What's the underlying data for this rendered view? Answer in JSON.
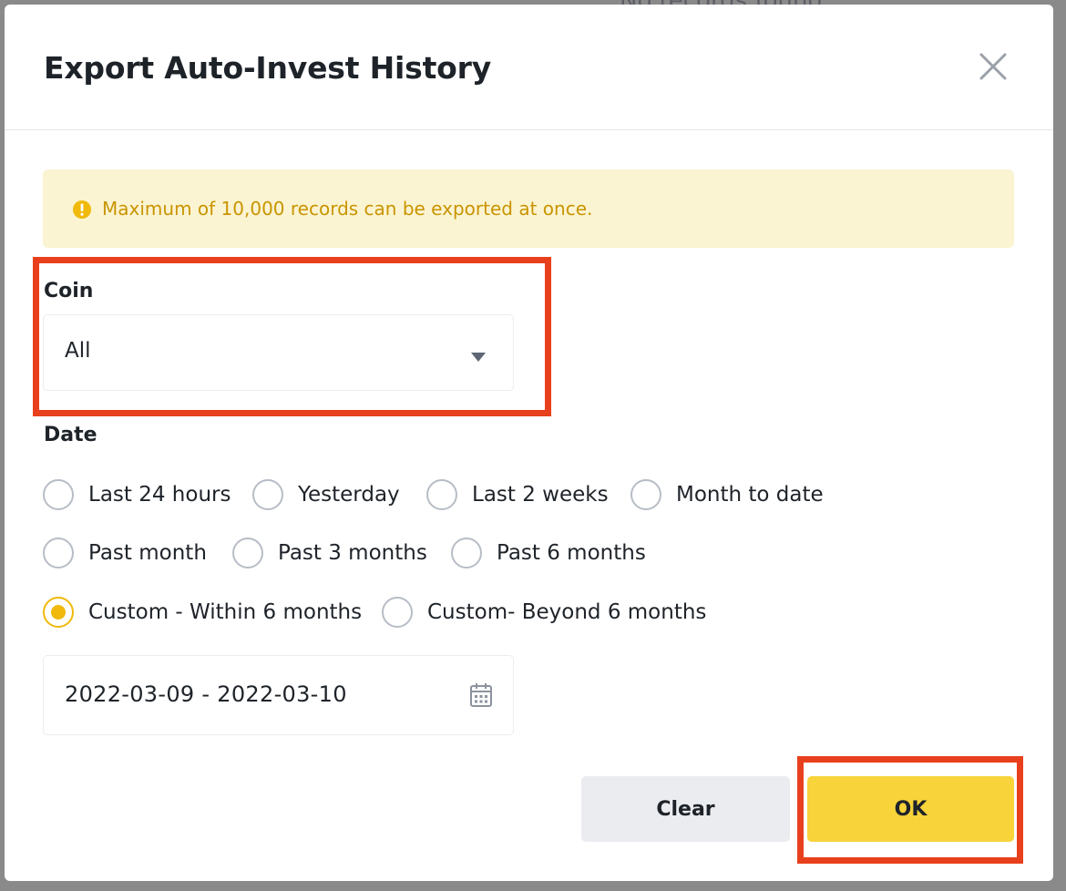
{
  "background": {
    "text": "No records found"
  },
  "dialog": {
    "title": "Export Auto-Invest History",
    "close_icon": "close-icon"
  },
  "notice": {
    "icon": "exclamation-circle-icon",
    "text": "Maximum of 10,000 records can be exported at once."
  },
  "coin": {
    "label": "Coin",
    "selected": "All",
    "caret_icon": "caret-down-icon"
  },
  "date": {
    "label": "Date",
    "options": [
      {
        "label": "Last 24 hours",
        "checked": false
      },
      {
        "label": "Yesterday",
        "checked": false
      },
      {
        "label": "Last 2 weeks",
        "checked": false
      },
      {
        "label": "Month to date",
        "checked": false
      },
      {
        "label": "Past month",
        "checked": false
      },
      {
        "label": "Past 3 months",
        "checked": false
      },
      {
        "label": "Past 6 months",
        "checked": false
      },
      {
        "label": "Custom - Within 6 months",
        "checked": true
      },
      {
        "label": "Custom- Beyond 6 months",
        "checked": false
      }
    ],
    "range": "2022-03-09 - 2022-03-10",
    "calendar_icon": "calendar-icon"
  },
  "buttons": {
    "clear": "Clear",
    "ok": "OK"
  },
  "colors": {
    "accent": "#f0b90b",
    "ok_button": "#f8d33a",
    "notice_bg": "#fbf4d2",
    "notice_text": "#c99400",
    "highlight": "#e8401c"
  }
}
